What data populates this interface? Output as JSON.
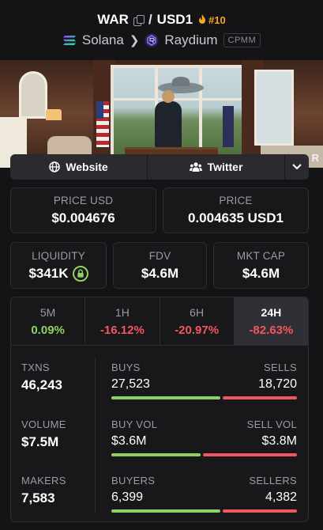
{
  "header": {
    "base_token": "WAR",
    "separator": "/",
    "quote_token": "USD1",
    "rank": "#10",
    "chain": "Solana",
    "dex": "Raydium",
    "pool_type": "CPMM"
  },
  "banner": {
    "partial_text": "R"
  },
  "links": {
    "website_label": "Website",
    "twitter_label": "Twitter"
  },
  "price_usd": {
    "label": "PRICE USD",
    "value": "$0.004676"
  },
  "price_native": {
    "label": "PRICE",
    "value": "0.004635 USD1"
  },
  "liquidity": {
    "label": "LIQUIDITY",
    "value": "$341K"
  },
  "fdv": {
    "label": "FDV",
    "value": "$4.6M"
  },
  "mkt_cap": {
    "label": "MKT CAP",
    "value": "$4.6M"
  },
  "timeframes": [
    {
      "label": "5M",
      "change": "0.09%",
      "direction": "up"
    },
    {
      "label": "1H",
      "change": "-16.12%",
      "direction": "down"
    },
    {
      "label": "6H",
      "change": "-20.97%",
      "direction": "down"
    },
    {
      "label": "24H",
      "change": "-82.63%",
      "direction": "down",
      "active": true
    }
  ],
  "txns": {
    "label": "TXNS",
    "value": "46,243",
    "left_label": "BUYS",
    "left_value": "27,523",
    "right_label": "SELLS",
    "right_value": "18,720",
    "buy_fraction": 0.595
  },
  "volume": {
    "label": "VOLUME",
    "value": "$7.5M",
    "left_label": "BUY VOL",
    "left_value": "$3.6M",
    "right_label": "SELL VOL",
    "right_value": "$3.8M",
    "buy_fraction": 0.486
  },
  "makers": {
    "label": "MAKERS",
    "value": "7,583",
    "left_label": "BUYERS",
    "left_value": "6,399",
    "right_label": "SELLERS",
    "right_value": "4,382",
    "buy_fraction": 0.594
  },
  "colors": {
    "positive": "#8fd163",
    "negative": "#f0575f",
    "rank": "#f5a623",
    "background": "#141416"
  },
  "icons": [
    "copy-icon",
    "flame-icon",
    "solana-icon",
    "raydium-icon",
    "globe-icon",
    "users-icon",
    "chevron-down-icon",
    "lock-icon"
  ]
}
